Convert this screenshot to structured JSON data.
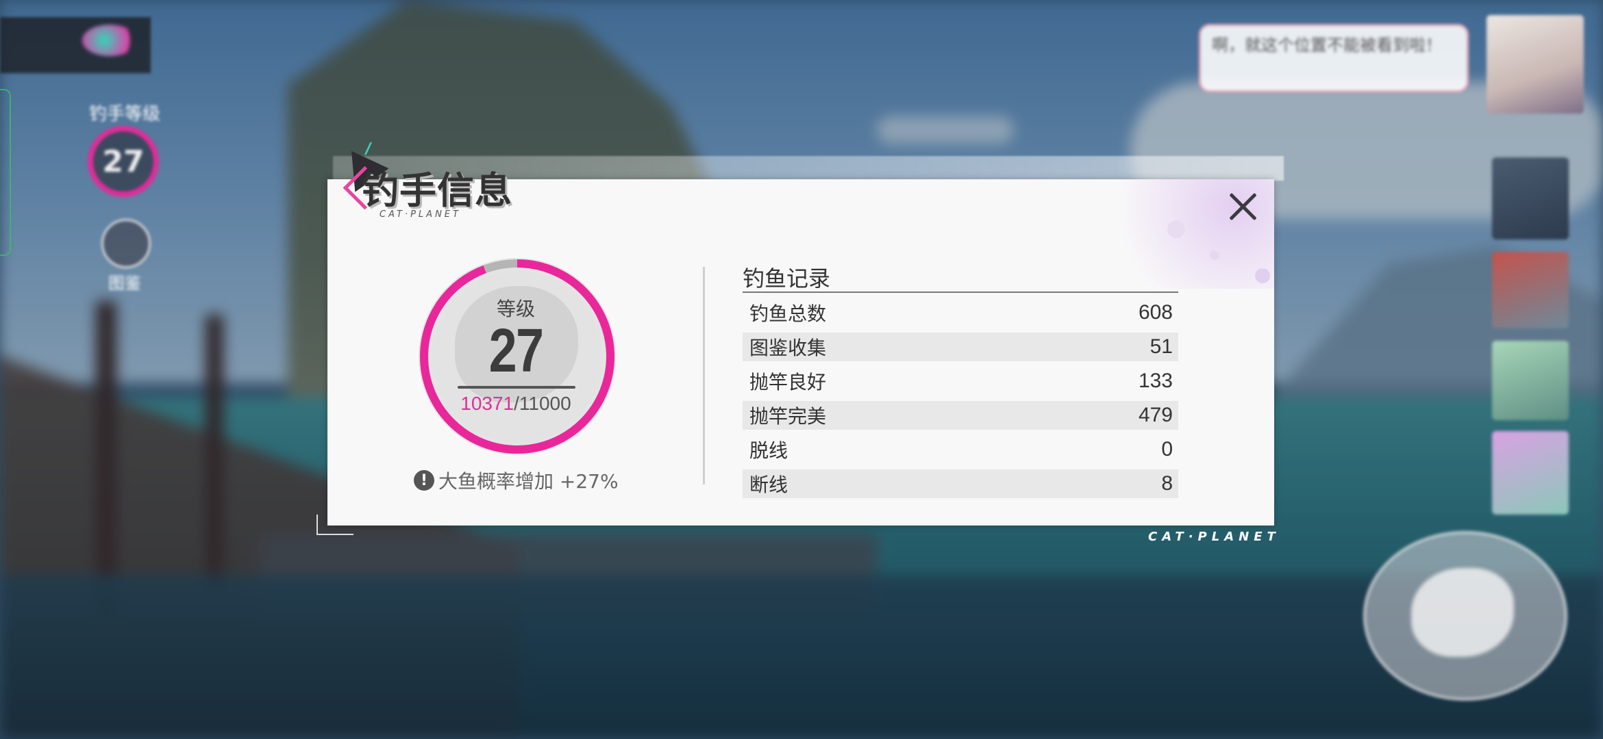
{
  "hud": {
    "level_label": "钓手等级",
    "level": "27",
    "avatar_label": "图鉴",
    "chat_text": "啊，就这个位置不能被看到啦！"
  },
  "panel": {
    "title": "钓手信息",
    "subtitle": "CAT·PLANET",
    "brand_corner": "CAT·PLANET",
    "level_label": "等级",
    "level_value": "27",
    "exp_current": "10371",
    "exp_sep": "/",
    "exp_max": "11000",
    "exp_progress": 0.943,
    "bonus_icon": "!",
    "bonus_text": "大鱼概率增加 +27%",
    "records_title": "钓鱼记录",
    "records": [
      {
        "label": "钓鱼总数",
        "value": "608"
      },
      {
        "label": "图鉴收集",
        "value": "51"
      },
      {
        "label": "抛竿良好",
        "value": "133"
      },
      {
        "label": "抛竿完美",
        "value": "479"
      },
      {
        "label": "脱线",
        "value": "0"
      },
      {
        "label": "断线",
        "value": "8"
      }
    ]
  },
  "colors": {
    "accent_pink": "#e9279b",
    "ring_track": "#b5b5b5",
    "panel_bg": "#f8f8f8"
  },
  "icons": {
    "close": "close-icon",
    "bonus": "exclamation-icon",
    "fish_action": "fish-icon"
  }
}
